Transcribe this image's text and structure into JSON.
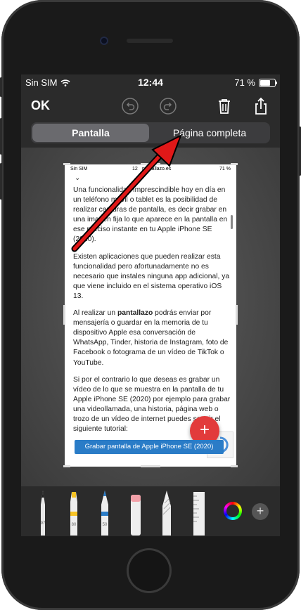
{
  "status_bar": {
    "carrier": "Sin SIM",
    "time": "12:44",
    "battery_text": "71 %",
    "battery_level": 0.71
  },
  "toolbar": {
    "done_label": "OK",
    "undo_icon": "undo-icon",
    "redo_icon": "redo-icon",
    "delete_icon": "trash-icon",
    "share_icon": "share-icon"
  },
  "segments": {
    "screen_label": "Pantalla",
    "fullpage_label": "Página completa",
    "selected": "Pantalla"
  },
  "preview": {
    "status": {
      "carrier": "Sin SIM",
      "time": "12",
      "url": "pantallazo.es",
      "battery": "71 %"
    },
    "paragraphs": [
      "Una funcionalidad imprescindible hoy en día en un teléfono móvil o tablet es la posibilidad de realizar capturas de pantalla, es decir grabar en una imagen fija lo que aparece en la pantalla en ese preciso instante en tu Apple iPhone SE (2020).",
      "Existen aplicaciones que pueden realizar esta funcionalidad pero afortunadamente no es necesario que instales ninguna app adicional, ya que viene incluido en el sistema operativo iOS 13."
    ],
    "p3_before": "Al realizar un ",
    "p3_bold": "pantallazo",
    "p3_after": " podrás enviar por mensajería o guardar en la memoria de tu dispositivo Apple esa conversación de WhatsApp, Tinder, historia de Instagram, foto de Facebook o fotograma de un vídeo de TikTok o YouTube.",
    "p4": "Si por el contrario lo que deseas es grabar un vídeo de lo que se muestra en la pantalla de tu Apple iPhone SE (2020) por ejemplo para grabar una videollamada, una historia, página web o trozo de un vídeo de internet puedes seguir el siguiente tutorial:",
    "button_label": "Grabar pantalla de Apple iPhone SE (2020)",
    "fab_label": "+"
  },
  "markup_tools": {
    "tool_names": [
      "pen-tool",
      "marker-tool",
      "pencil-tool",
      "eraser-tool",
      "lasso-tool",
      "ruler-tool"
    ],
    "pen_width": "97",
    "marker_width": "80",
    "pencil_width": "50",
    "add_label": "+"
  },
  "colors": {
    "screen_bg": "#2b2b2b",
    "arrow": "#e01818",
    "button": "#2a7cc7",
    "fab": "#e23b3b"
  }
}
